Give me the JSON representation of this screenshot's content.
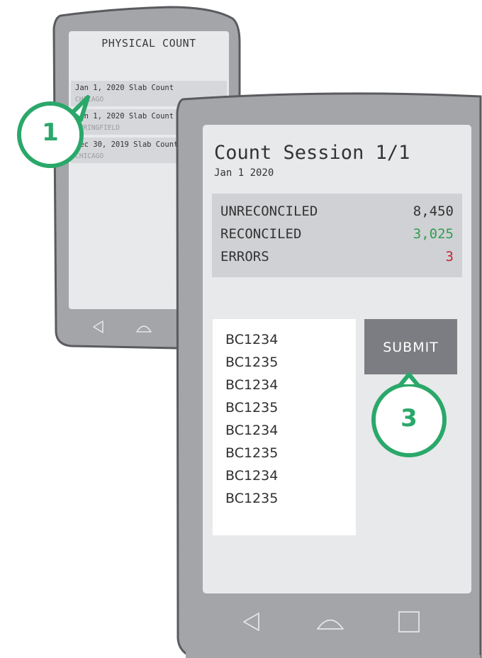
{
  "colors": {
    "phone_frame": "#a4a5a9",
    "phone_border": "#5a5b5f",
    "screen": "#e8e9eb",
    "reconciled_green": "#2e9e52",
    "error_red": "#c2262e",
    "badge_green": "#2aa86a"
  },
  "back_phone": {
    "title": "PHYSICAL COUNT",
    "items": [
      {
        "title": "Jan 1, 2020 Slab Count",
        "subtitle": "CHICAGO"
      },
      {
        "title": "Jan 1, 2020 Slab Count",
        "subtitle": "SPRINGFIELD"
      },
      {
        "title": "Dec 30, 2019 Slab Count",
        "subtitle": "CHICAGO"
      }
    ],
    "nav_icons": [
      "back-icon",
      "home-icon"
    ]
  },
  "front_phone": {
    "session_title": "Count Session 1/1",
    "session_date": "Jan 1 2020",
    "stats": [
      {
        "label": "UNRECONCILED",
        "value": "8,450",
        "color": "#333333"
      },
      {
        "label": "RECONCILED",
        "value": "3,025",
        "color": "#2e9e52"
      },
      {
        "label": "ERRORS",
        "value": "3",
        "color": "#c2262e"
      }
    ],
    "codes": [
      "BC1234",
      "BC1235",
      "BC1234",
      "BC1235",
      "BC1234",
      "BC1235",
      "BC1234",
      "BC1235"
    ],
    "submit_label": "SUBMIT",
    "nav_icons": [
      "back-icon",
      "home-icon",
      "recents-icon"
    ]
  },
  "callouts": [
    {
      "number": "1"
    },
    {
      "number": "3"
    }
  ]
}
